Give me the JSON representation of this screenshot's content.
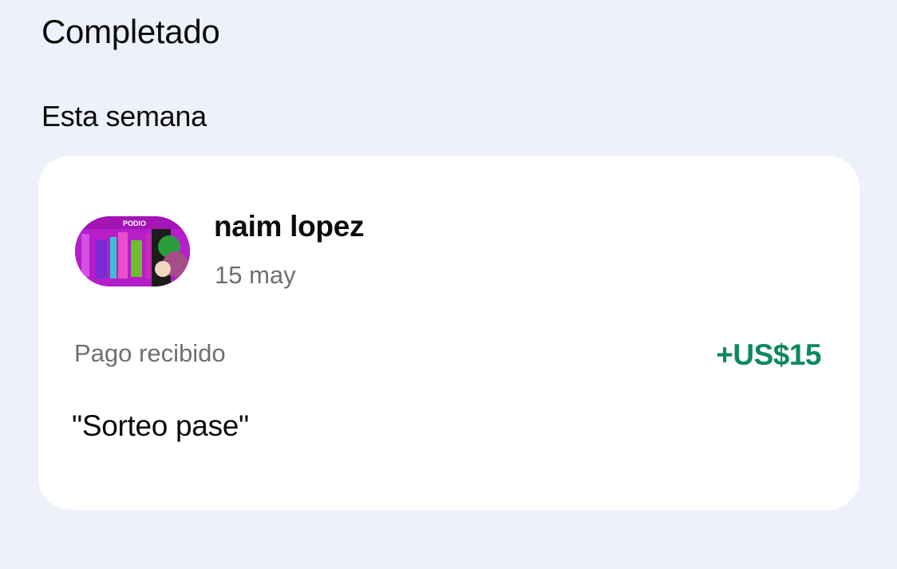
{
  "section": {
    "title": "Completado"
  },
  "group": {
    "title": "Esta semana"
  },
  "transaction": {
    "name": "naim lopez",
    "date": "15 may",
    "type": "Pago recibido",
    "amount": "+US$15",
    "note": "\"Sorteo pase\"",
    "avatar_icon": "profile-image-icon",
    "avatar_text": "PODIO"
  },
  "colors": {
    "background": "#eef1fa",
    "card": "#ffffff",
    "amount_positive": "#0a8a5a",
    "secondary_text": "#6f6f6f",
    "avatar_magenta": "#b51ec9"
  }
}
